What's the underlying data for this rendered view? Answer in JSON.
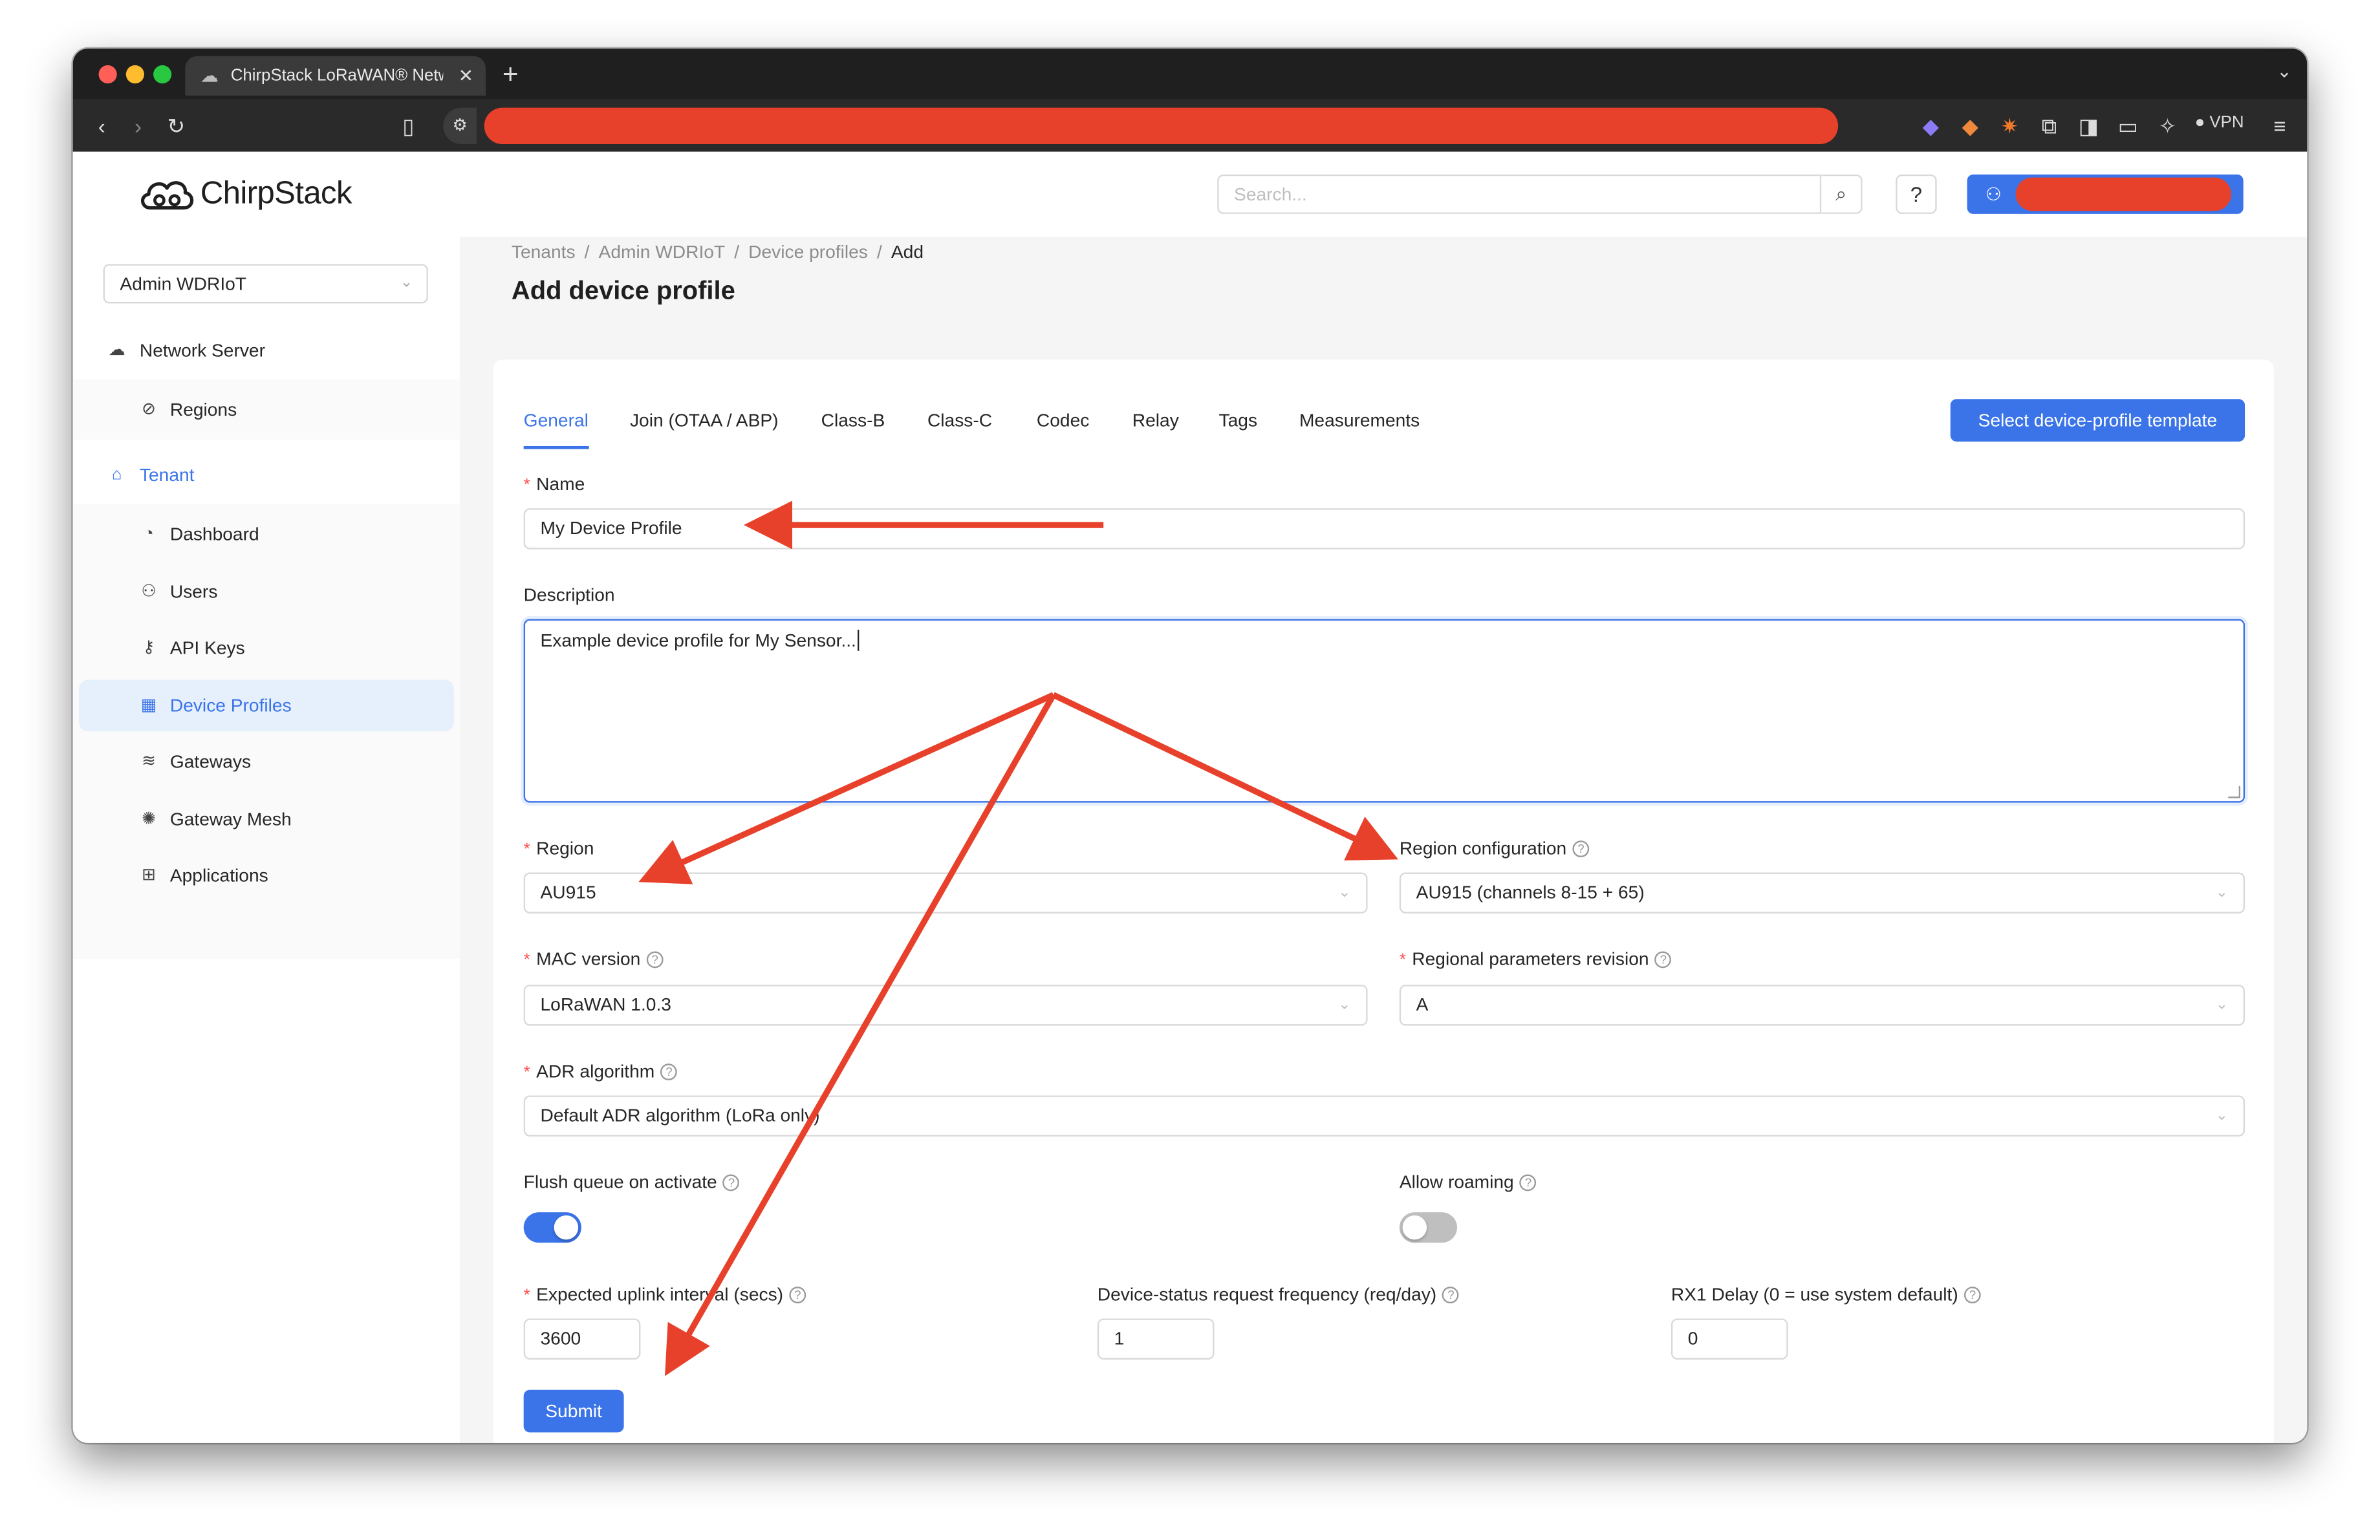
{
  "browser": {
    "tab_title": "ChirpStack LoRaWAN® Netw",
    "tab_icon": "cloud-icon",
    "new_tab": "+",
    "vpn_label": "VPN"
  },
  "app": {
    "logo_text": "ChirpStack",
    "search_placeholder": "Search...",
    "help_label": "?"
  },
  "sidebar": {
    "tenant_select": "Admin WDRIoT",
    "items": [
      {
        "label": "Network Server",
        "icon": "cloud-icon"
      },
      {
        "label": "Regions",
        "icon": "compass-icon"
      },
      {
        "label": "Tenant",
        "icon": "home-icon"
      },
      {
        "label": "Dashboard",
        "icon": "dashboard-icon"
      },
      {
        "label": "Users",
        "icon": "user-icon"
      },
      {
        "label": "API Keys",
        "icon": "key-icon"
      },
      {
        "label": "Device Profiles",
        "icon": "profile-icon"
      },
      {
        "label": "Gateways",
        "icon": "wifi-icon"
      },
      {
        "label": "Gateway Mesh",
        "icon": "mesh-icon"
      },
      {
        "label": "Applications",
        "icon": "apps-icon"
      }
    ]
  },
  "breadcrumb": [
    "Tenants",
    "Admin WDRIoT",
    "Device profiles",
    "Add"
  ],
  "page_title": "Add device profile",
  "tabs": [
    "General",
    "Join (OTAA / ABP)",
    "Class-B",
    "Class-C",
    "Codec",
    "Relay",
    "Tags",
    "Measurements"
  ],
  "template_button": "Select device-profile template",
  "form": {
    "name_label": "Name",
    "name_value": "My Device Profile",
    "description_label": "Description",
    "description_value": "Example device profile for My Sensor...",
    "region_label": "Region",
    "region_value": "AU915",
    "region_config_label": "Region configuration",
    "region_config_value": "AU915 (channels 8-15 + 65)",
    "mac_label": "MAC version",
    "mac_value": "LoRaWAN 1.0.3",
    "rp_label": "Regional parameters revision",
    "rp_value": "A",
    "adr_label": "ADR algorithm",
    "adr_value": "Default ADR algorithm (LoRa only)",
    "flush_label": "Flush queue on activate",
    "flush_on": true,
    "roaming_label": "Allow roaming",
    "roaming_on": false,
    "uplink_label": "Expected uplink interval (secs)",
    "uplink_value": "3600",
    "status_label": "Device-status request frequency (req/day)",
    "status_value": "1",
    "rx1_label": "RX1 Delay (0 = use system default)",
    "rx1_value": "0",
    "submit": "Submit"
  },
  "colors": {
    "accent": "#3b74e8",
    "annotation": "#e8412b",
    "required": "#ff4d4f"
  }
}
